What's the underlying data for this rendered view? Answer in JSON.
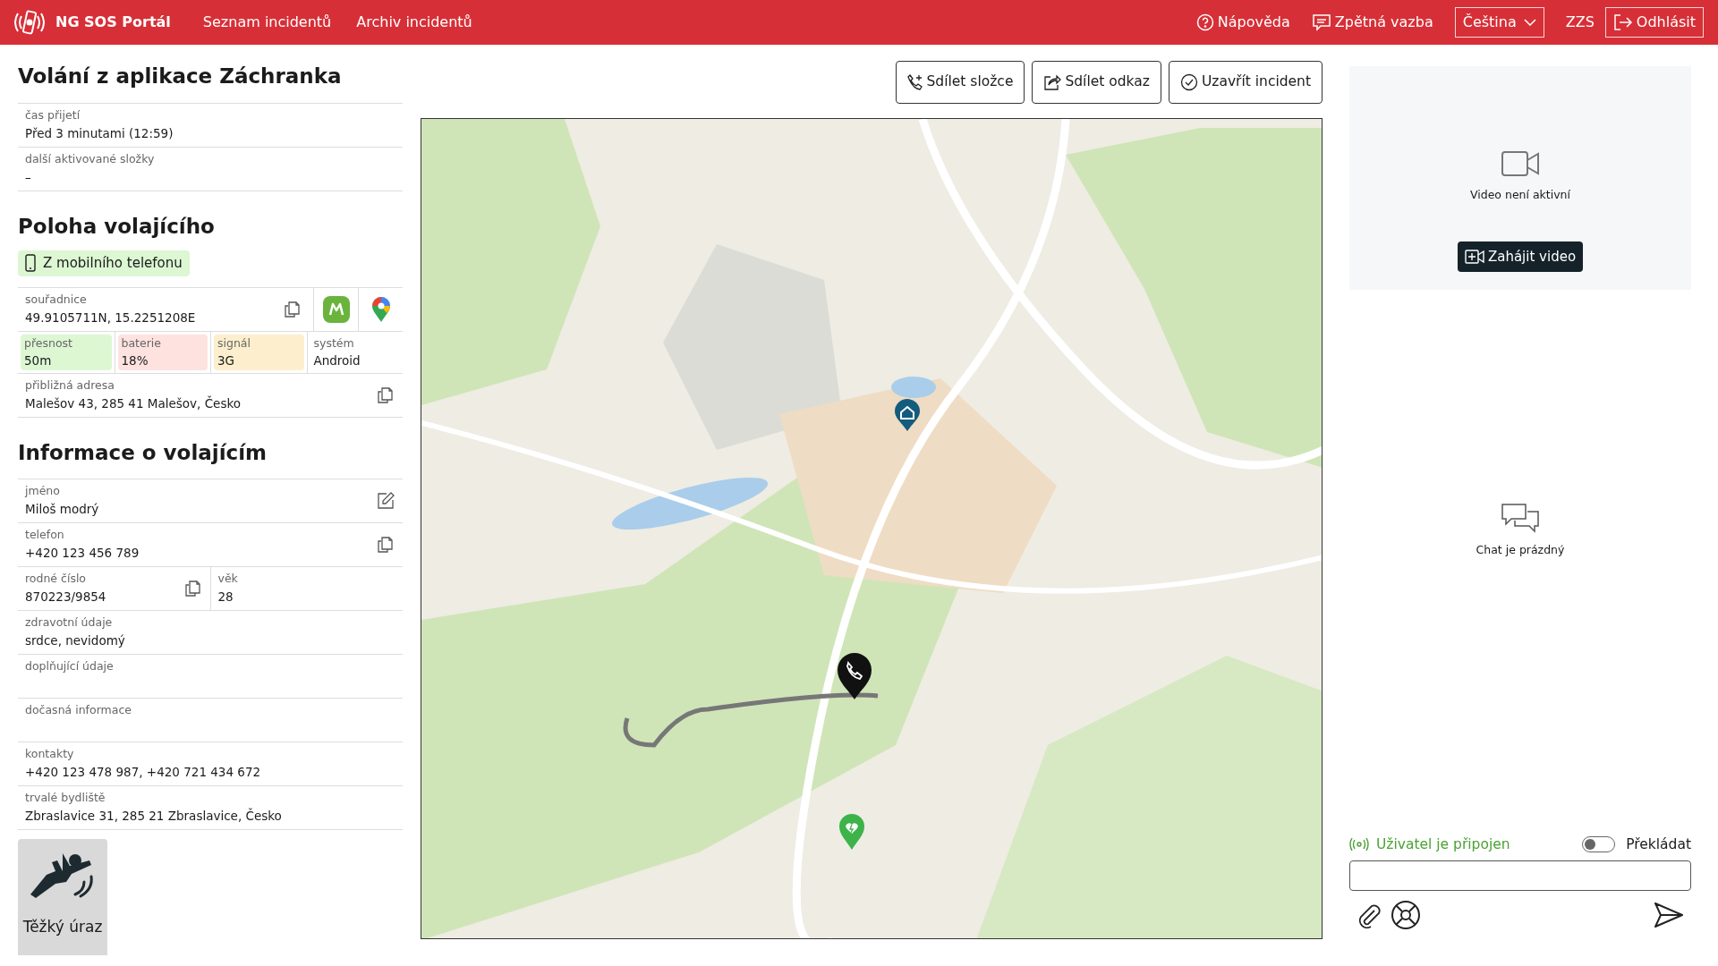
{
  "header": {
    "brand": "NG SOS Portál",
    "nav": [
      "Seznam incidentů",
      "Archiv incidentů"
    ],
    "help": "Nápověda",
    "feedback": "Zpětná vazba",
    "language": "Čeština",
    "role": "ZZS",
    "logout": "Odhlásit"
  },
  "incident": {
    "title": "Volání z aplikace Záchranka",
    "fields": [
      {
        "label": "čas přijetí",
        "value": "Před 3 minutami (12:59)"
      },
      {
        "label": "další aktivované složky",
        "value": "–"
      }
    ]
  },
  "location": {
    "title": "Poloha volajícího",
    "source": "Z mobilního telefonu",
    "coordinates": {
      "label": "souřadnice",
      "value": "49.9105711N, 15.2251208E"
    },
    "metrics": [
      {
        "label": "přesnost",
        "value": "50m",
        "color": "#ddf7d3"
      },
      {
        "label": "baterie",
        "value": "18%",
        "color": "#fde2e0"
      },
      {
        "label": "signál",
        "value": "3G",
        "color": "#fdefcd"
      },
      {
        "label": "systém",
        "value": "Android",
        "color": "#ffffff"
      }
    ],
    "address": {
      "label": "přibližná adresa",
      "value": "Malešov 43, 285 41 Malešov, Česko"
    }
  },
  "caller": {
    "title": "Informace o volajícím",
    "rows": [
      [
        {
          "label": "jméno",
          "value": "Miloš modrý",
          "kind": "editable"
        }
      ],
      [
        {
          "label": "telefon",
          "value": " +420 123 456 789",
          "kind": "copyable"
        }
      ],
      [
        {
          "label": "rodné číslo",
          "value": "870223/9854",
          "kind": "copyable"
        },
        {
          "label": "věk",
          "value": "28",
          "kind": "plain"
        }
      ],
      [
        {
          "label": "zdravotní údaje",
          "value": "srdce, nevidomý",
          "kind": "plain"
        }
      ],
      [
        {
          "label": "doplňující údaje",
          "kind": "plain"
        }
      ],
      [
        {
          "label": "dočasná informace",
          "kind": "plain"
        }
      ],
      [
        {
          "label": "kontakty",
          "value": "+420 123 478 987, +420 721 434 672",
          "kind": "plain"
        }
      ],
      [
        {
          "label": "trvalé bydliště",
          "value": "Zbraslavice 31, 285 21 Zbraslavice, Česko",
          "kind": "plain"
        }
      ]
    ]
  },
  "category": {
    "label": "Těžký úraz"
  },
  "actions": [
    {
      "label": "Sdílet složce",
      "kind": "phone"
    },
    {
      "label": "Sdílet odkaz",
      "kind": "share"
    },
    {
      "label": "Uzavřít incident",
      "kind": "check"
    }
  ],
  "video": {
    "status": "Video není aktivní",
    "button": "Zahájit video"
  },
  "chat": {
    "empty": "Chat je prázdný",
    "connection": "Uživatel je připojen",
    "translate": {
      "label": "Překládat",
      "on": false
    }
  }
}
